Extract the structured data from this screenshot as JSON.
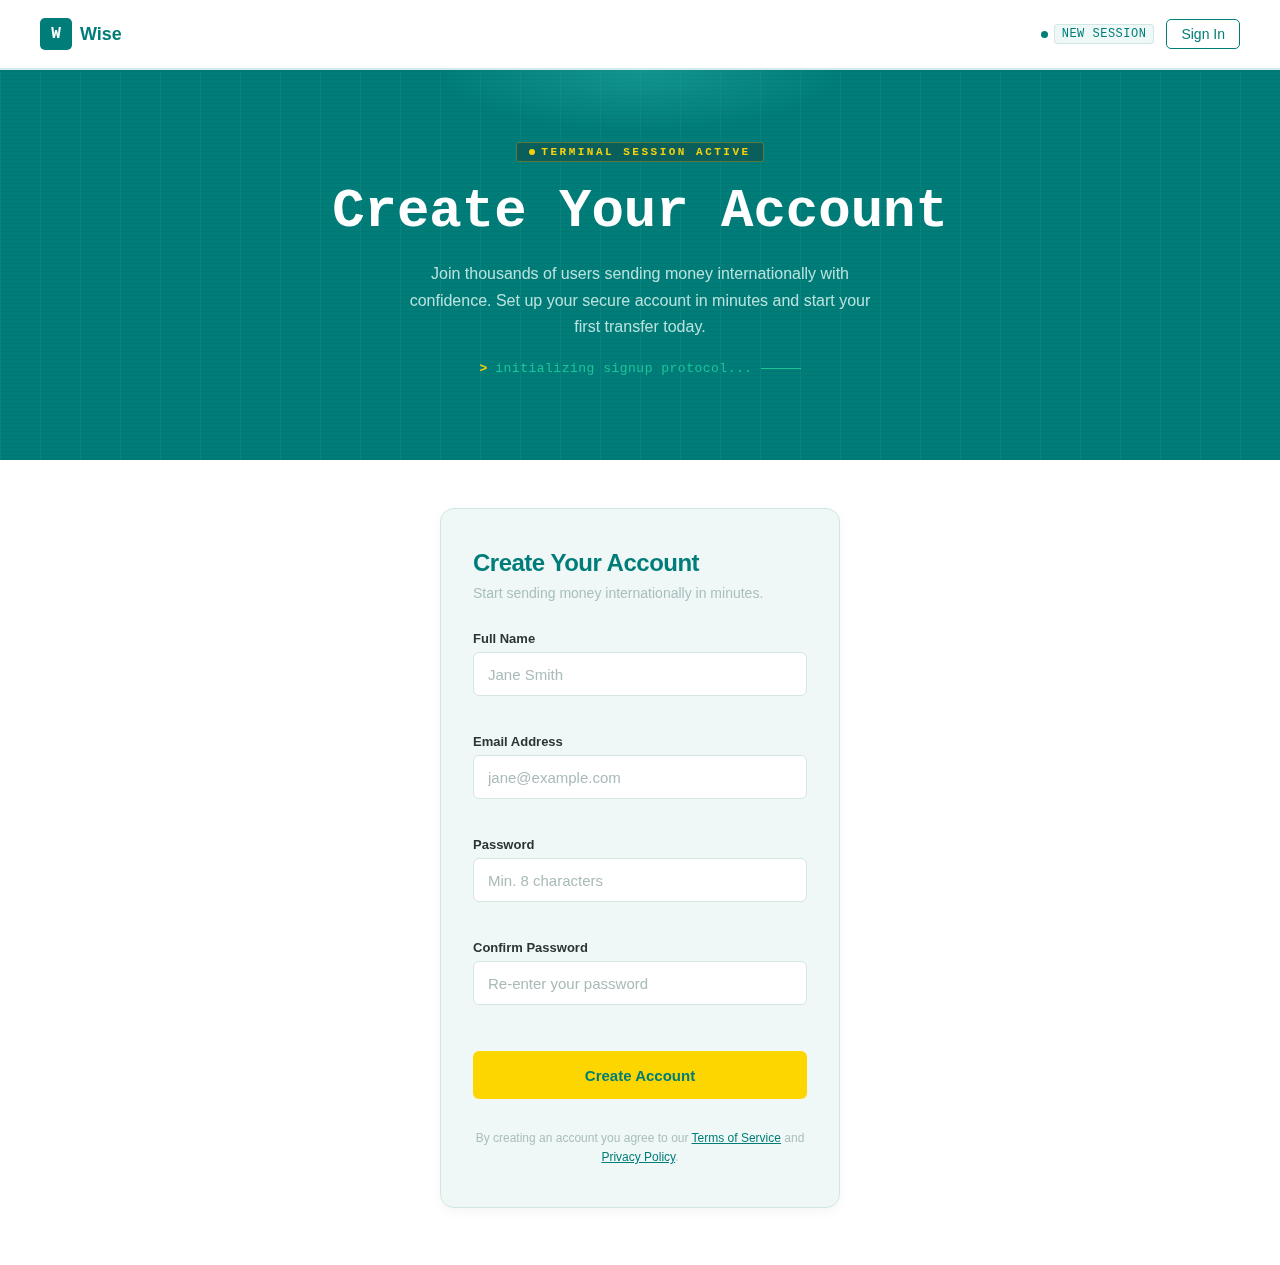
{
  "header": {
    "logo_letter": "W",
    "brand": "Wise",
    "session_badge": "NEW SESSION",
    "sign_in": "Sign In"
  },
  "hero": {
    "badge": "TERMINAL SESSION ACTIVE",
    "title": "Create Your Account",
    "subtitle": "Join thousands of users sending money internationally with confidence. Set up your secure account in minutes and start your first transfer today.",
    "prompt": ">",
    "command": "initializing signup protocol..."
  },
  "form": {
    "title": "Create Your Account",
    "subtitle": "Start sending money internationally in minutes.",
    "fields": [
      {
        "label": "Full Name",
        "placeholder": "Jane Smith"
      },
      {
        "label": "Email Address",
        "placeholder": "jane@example.com"
      },
      {
        "label": "Password",
        "placeholder": "Min. 8 characters"
      },
      {
        "label": "Confirm Password",
        "placeholder": "Re-enter your password"
      }
    ],
    "submit": "Create Account",
    "terms": {
      "before": "By creating an account you agree to our",
      "link_1": "Terms of Service",
      "middle": "and",
      "link_2": "Privacy Policy",
      "after": "."
    }
  }
}
